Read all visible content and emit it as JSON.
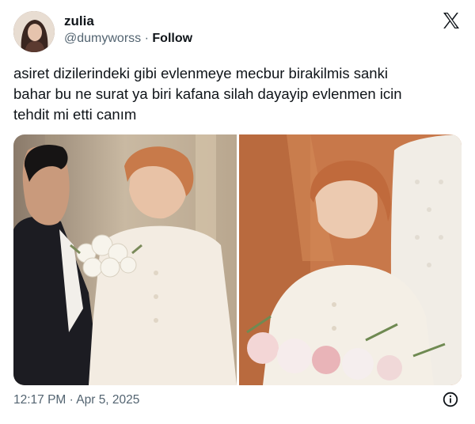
{
  "author": {
    "name": "zulia",
    "handle": "@dumyworss",
    "separator": "·",
    "follow_label": "Follow"
  },
  "tweet": {
    "lines": [
      "asiret dizilerindeki gibi evlenmeye mecbur birakilmis sanki",
      "bahar bu ne surat ya biri kafana silah dayayip evlenmen icin",
      "tehdit mi etti canım"
    ],
    "timestamp": "12:17 PM · Apr 5, 2025"
  },
  "icons": {
    "brand": "x-logo-icon",
    "info": "info-icon"
  },
  "colors": {
    "text": "#0f1419",
    "secondary": "#536471",
    "background": "#ffffff"
  }
}
